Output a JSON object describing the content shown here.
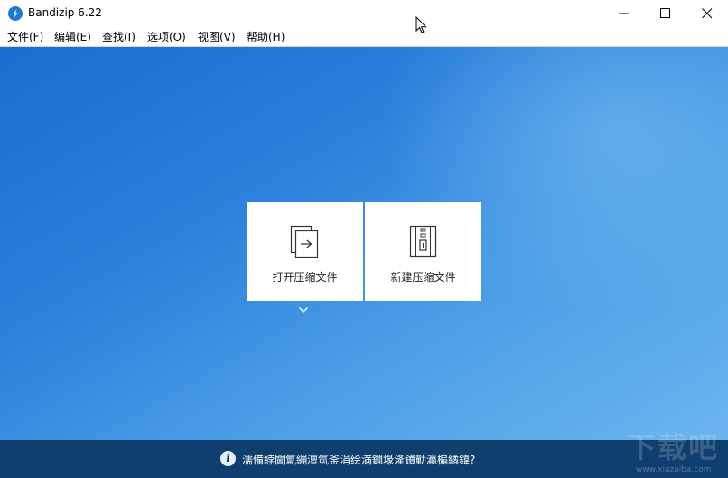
{
  "window": {
    "title": "Bandizip 6.22",
    "app_icon": "bandizip-logo-icon",
    "controls": [
      "minimize-icon",
      "maximize-icon",
      "close-icon"
    ]
  },
  "menu": {
    "items": [
      {
        "label": "文件(F)"
      },
      {
        "label": "编辑(E)"
      },
      {
        "label": "查找(I)"
      },
      {
        "label": "选项(O)"
      },
      {
        "label": "视图(V)"
      },
      {
        "label": "帮助(H)"
      }
    ]
  },
  "main": {
    "cards": [
      {
        "label": "打开压缩文件",
        "icon": "open-archive-icon"
      },
      {
        "label": "新建压缩文件",
        "icon": "new-archive-icon"
      }
    ],
    "expand_icon": "chevron-down-icon",
    "colors": {
      "gradient_start": "#1a6ecf",
      "gradient_end": "#6cb4ee"
    }
  },
  "status": {
    "icon": "info-icon",
    "icon_glyph": "i",
    "text": "濡備綍閫氳繃澶氫釜涓绘満鐗堟湰鐨勭瀛楄繘鍏?",
    "background": "#0f3f6e"
  },
  "watermark": {
    "text": "下载吧",
    "url": "www.xiazaiba.com"
  }
}
